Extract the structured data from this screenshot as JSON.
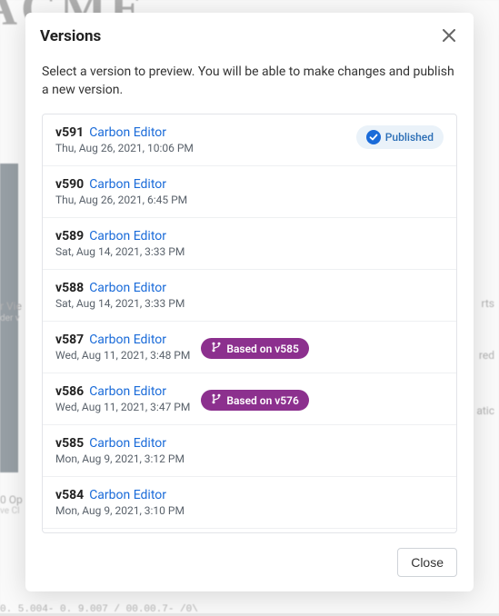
{
  "backdrop": {
    "brand": "ACME",
    "r1": "r Vie",
    "r2": "der v",
    "r3": "rts",
    "r4": "red",
    "r5": "atic",
    "r6": "0 Op",
    "r7": "ve Cl",
    "r8": "0. 5.004- 0. 9.007 / 00.00.7- /0\\"
  },
  "modal": {
    "title": "Versions",
    "description": "Select a version to preview. You will be able to make changes and publish a new version.",
    "close_button": "Close",
    "published_label": "Published"
  },
  "versions": [
    {
      "num": "v591",
      "editor": "Carbon Editor",
      "time": "Thu, Aug 26, 2021, 10:06 PM",
      "published": true
    },
    {
      "num": "v590",
      "editor": "Carbon Editor",
      "time": "Thu, Aug 26, 2021, 6:45 PM"
    },
    {
      "num": "v589",
      "editor": "Carbon Editor",
      "time": "Sat, Aug 14, 2021, 3:33 PM"
    },
    {
      "num": "v588",
      "editor": "Carbon Editor",
      "time": "Sat, Aug 14, 2021, 3:33 PM"
    },
    {
      "num": "v587",
      "editor": "Carbon Editor",
      "time": "Wed, Aug 11, 2021, 3:48 PM",
      "based_on": "Based on v585"
    },
    {
      "num": "v586",
      "editor": "Carbon Editor",
      "time": "Wed, Aug 11, 2021, 3:47 PM",
      "based_on": "Based on v576"
    },
    {
      "num": "v585",
      "editor": "Carbon Editor",
      "time": "Mon, Aug 9, 2021, 3:12 PM"
    },
    {
      "num": "v584",
      "editor": "Carbon Editor",
      "time": "Mon, Aug 9, 2021, 3:10 PM"
    }
  ]
}
